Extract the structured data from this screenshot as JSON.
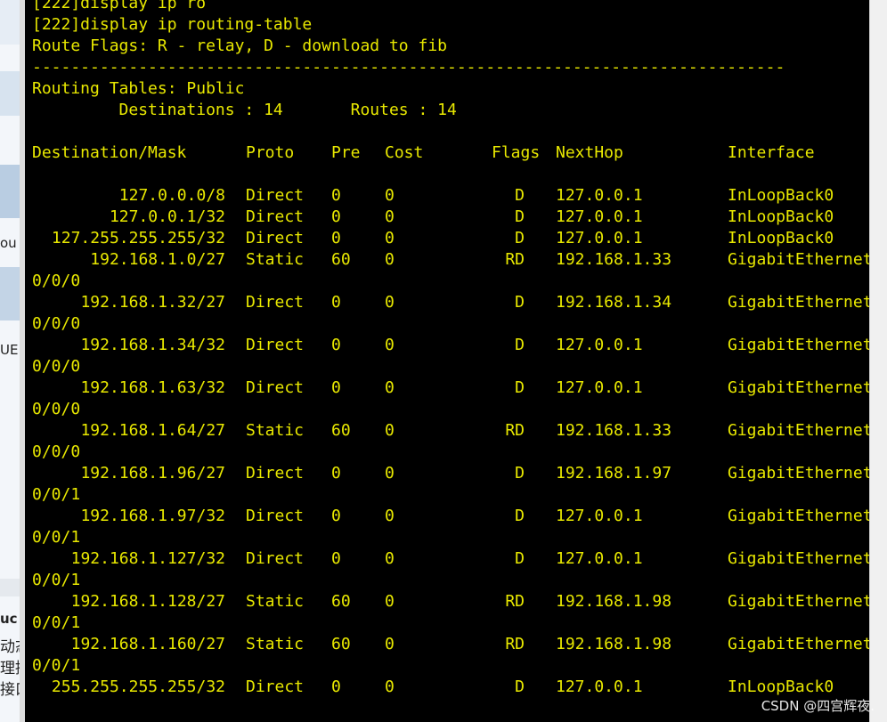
{
  "left_panel": {
    "fragments": [
      "ou",
      "UE",
      "uc",
      "动态",
      "理接",
      "接口"
    ]
  },
  "terminal": {
    "lines_before": [
      "[222]display ip ro",
      "[222]display ip routing-table",
      "Route Flags: R - relay, D - download to fib",
      "------------------------------------------------------------------------------",
      "Routing Tables: Public",
      "         Destinations : 14       Routes : 14",
      ""
    ],
    "header": {
      "destination": "Destination/Mask",
      "proto": "Proto",
      "pre": "Pre",
      "cost": "Cost",
      "flags": "Flags",
      "nexthop": "NextHop",
      "interface": "Interface"
    },
    "routes": [
      {
        "destination": "127.0.0.0/8",
        "proto": "Direct",
        "pre": "0",
        "cost": "0",
        "flags": "D",
        "nexthop": "127.0.0.1",
        "interface": "InLoopBack0",
        "wrap": ""
      },
      {
        "destination": "127.0.0.1/32",
        "proto": "Direct",
        "pre": "0",
        "cost": "0",
        "flags": "D",
        "nexthop": "127.0.0.1",
        "interface": "InLoopBack0",
        "wrap": ""
      },
      {
        "destination": "127.255.255.255/32",
        "proto": "Direct",
        "pre": "0",
        "cost": "0",
        "flags": "D",
        "nexthop": "127.0.0.1",
        "interface": "InLoopBack0",
        "wrap": ""
      },
      {
        "destination": "192.168.1.0/27",
        "proto": "Static",
        "pre": "60",
        "cost": "0",
        "flags": "RD",
        "nexthop": "192.168.1.33",
        "interface": "GigabitEthernet",
        "wrap": "0/0/0"
      },
      {
        "destination": "192.168.1.32/27",
        "proto": "Direct",
        "pre": "0",
        "cost": "0",
        "flags": "D",
        "nexthop": "192.168.1.34",
        "interface": "GigabitEthernet",
        "wrap": "0/0/0"
      },
      {
        "destination": "192.168.1.34/32",
        "proto": "Direct",
        "pre": "0",
        "cost": "0",
        "flags": "D",
        "nexthop": "127.0.0.1",
        "interface": "GigabitEthernet",
        "wrap": "0/0/0"
      },
      {
        "destination": "192.168.1.63/32",
        "proto": "Direct",
        "pre": "0",
        "cost": "0",
        "flags": "D",
        "nexthop": "127.0.0.1",
        "interface": "GigabitEthernet",
        "wrap": "0/0/0"
      },
      {
        "destination": "192.168.1.64/27",
        "proto": "Static",
        "pre": "60",
        "cost": "0",
        "flags": "RD",
        "nexthop": "192.168.1.33",
        "interface": "GigabitEthernet",
        "wrap": "0/0/0"
      },
      {
        "destination": "192.168.1.96/27",
        "proto": "Direct",
        "pre": "0",
        "cost": "0",
        "flags": "D",
        "nexthop": "192.168.1.97",
        "interface": "GigabitEthernet",
        "wrap": "0/0/1"
      },
      {
        "destination": "192.168.1.97/32",
        "proto": "Direct",
        "pre": "0",
        "cost": "0",
        "flags": "D",
        "nexthop": "127.0.0.1",
        "interface": "GigabitEthernet",
        "wrap": "0/0/1"
      },
      {
        "destination": "192.168.1.127/32",
        "proto": "Direct",
        "pre": "0",
        "cost": "0",
        "flags": "D",
        "nexthop": "127.0.0.1",
        "interface": "GigabitEthernet",
        "wrap": "0/0/1"
      },
      {
        "destination": "192.168.1.128/27",
        "proto": "Static",
        "pre": "60",
        "cost": "0",
        "flags": "RD",
        "nexthop": "192.168.1.98",
        "interface": "GigabitEthernet",
        "wrap": "0/0/1"
      },
      {
        "destination": "192.168.1.160/27",
        "proto": "Static",
        "pre": "60",
        "cost": "0",
        "flags": "RD",
        "nexthop": "192.168.1.98",
        "interface": "GigabitEthernet",
        "wrap": "0/0/1"
      },
      {
        "destination": "255.255.255.255/32",
        "proto": "Direct",
        "pre": "0",
        "cost": "0",
        "flags": "D",
        "nexthop": "127.0.0.1",
        "interface": "InLoopBack0",
        "wrap": ""
      }
    ],
    "text_color": "#e8e800",
    "background": "#000000"
  },
  "watermark": "CSDN @四宫辉夜."
}
